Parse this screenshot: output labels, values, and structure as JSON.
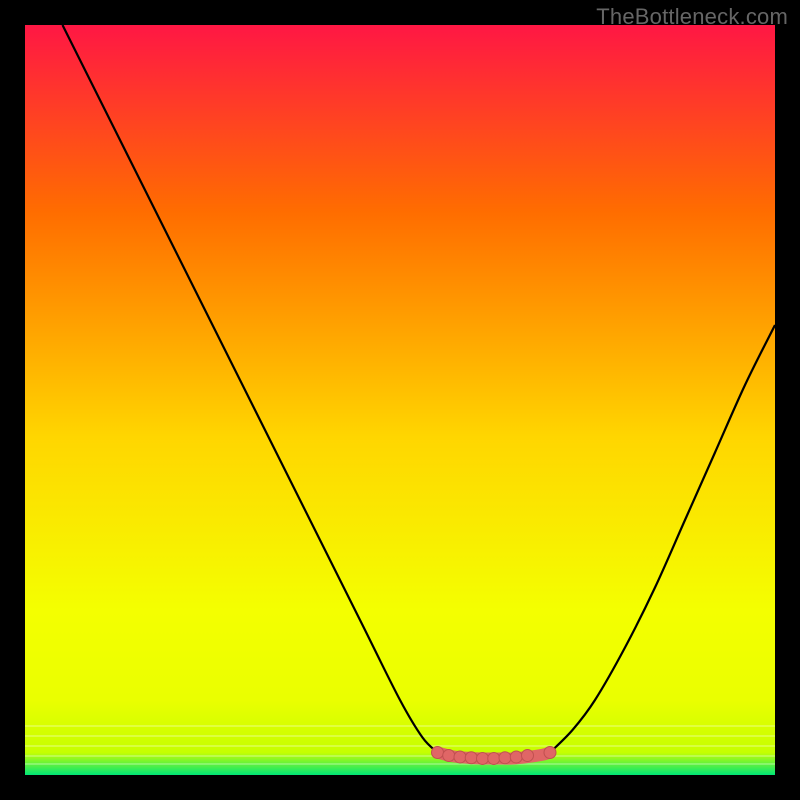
{
  "watermark": "TheBottleneck.com",
  "colors": {
    "frame": "#000000",
    "grad_top": "#ff1744",
    "grad_mid1": "#ff6d00",
    "grad_mid2": "#ffd600",
    "grad_mid3": "#f4ff00",
    "grad_bottom_y": "#eaff00",
    "grad_green": "#00e676",
    "curve": "#000000",
    "marker_fill": "#e06666",
    "marker_stroke": "#c05050"
  },
  "chart_data": {
    "type": "line",
    "title": "",
    "xlabel": "",
    "ylabel": "",
    "xlim": [
      0,
      100
    ],
    "ylim": [
      0,
      100
    ],
    "series": [
      {
        "name": "left-curve",
        "x": [
          5,
          10,
          15,
          20,
          25,
          30,
          35,
          40,
          45,
          50,
          53,
          55
        ],
        "y": [
          100,
          90,
          80,
          70,
          60,
          50,
          40,
          30,
          20,
          10,
          5,
          3
        ]
      },
      {
        "name": "right-curve",
        "x": [
          70,
          73,
          76,
          80,
          84,
          88,
          92,
          96,
          100
        ],
        "y": [
          3,
          6,
          10,
          17,
          25,
          34,
          43,
          52,
          60
        ]
      },
      {
        "name": "valley-band",
        "x": [
          55,
          57,
          59,
          61,
          63,
          65,
          67,
          69,
          70
        ],
        "y": [
          3,
          2.5,
          2.3,
          2.2,
          2.2,
          2.2,
          2.4,
          2.7,
          3
        ]
      }
    ],
    "markers": {
      "name": "valley-markers",
      "x": [
        55,
        56.5,
        58,
        59.5,
        61,
        62.5,
        64,
        65.5,
        67,
        70
      ],
      "y": [
        3,
        2.6,
        2.4,
        2.3,
        2.2,
        2.2,
        2.3,
        2.4,
        2.6,
        3
      ]
    }
  }
}
